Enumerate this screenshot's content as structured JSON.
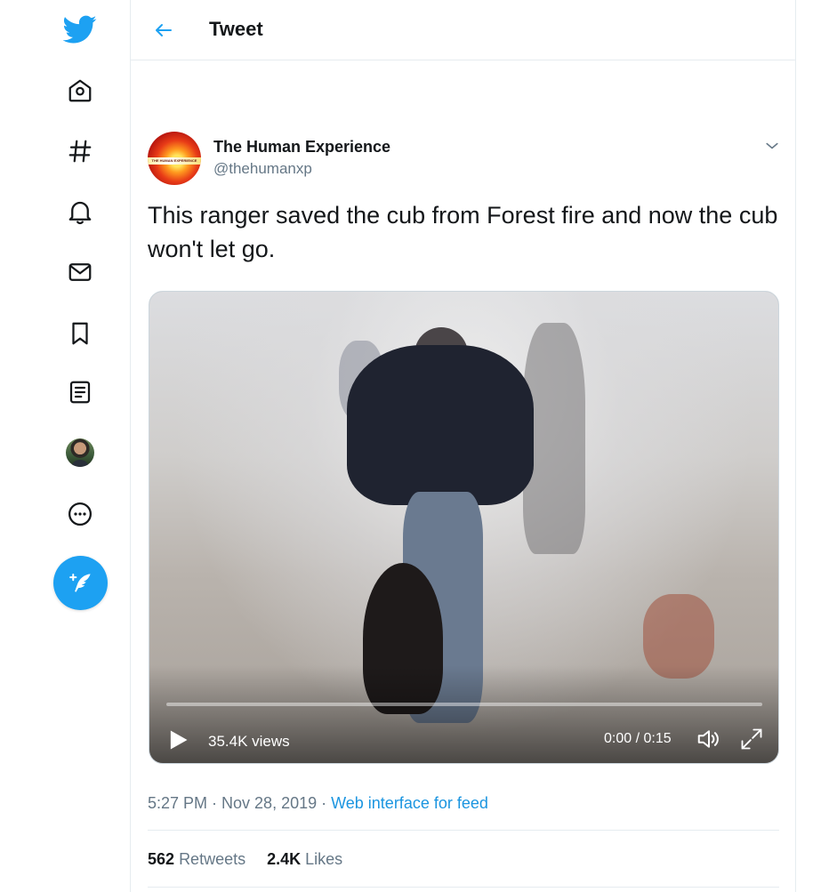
{
  "nav": {
    "items": [
      {
        "icon": "twitter-logo-icon"
      },
      {
        "icon": "home-icon"
      },
      {
        "icon": "explore-hashtag-icon"
      },
      {
        "icon": "notifications-bell-icon"
      },
      {
        "icon": "messages-envelope-icon"
      },
      {
        "icon": "bookmarks-icon"
      },
      {
        "icon": "lists-icon"
      },
      {
        "icon": "profile-avatar"
      },
      {
        "icon": "more-icon"
      }
    ],
    "compose_icon": "compose-feather-icon"
  },
  "header": {
    "title": "Tweet"
  },
  "tweet": {
    "author": {
      "display_name": "The Human Experience",
      "handle": "@thehumanxp",
      "avatar_text": "THE HUMAN EXPERIENCE"
    },
    "text": "This ranger saved the cub from Forest fire and now the cub won't let go.",
    "video": {
      "views": "35.4K views",
      "time": "0:00 / 0:15",
      "progress": 0
    },
    "timestamp": "5:27 PM · Nov 28, 2019 · ",
    "source": "Web interface for feed",
    "retweets_count": "562",
    "retweets_label": "Retweets",
    "likes_count": "2.4K",
    "likes_label": "Likes"
  },
  "colors": {
    "brand": "#1da1f2",
    "link": "#1b95e0",
    "secondary_text": "#657786",
    "border": "#e6ecf0"
  }
}
